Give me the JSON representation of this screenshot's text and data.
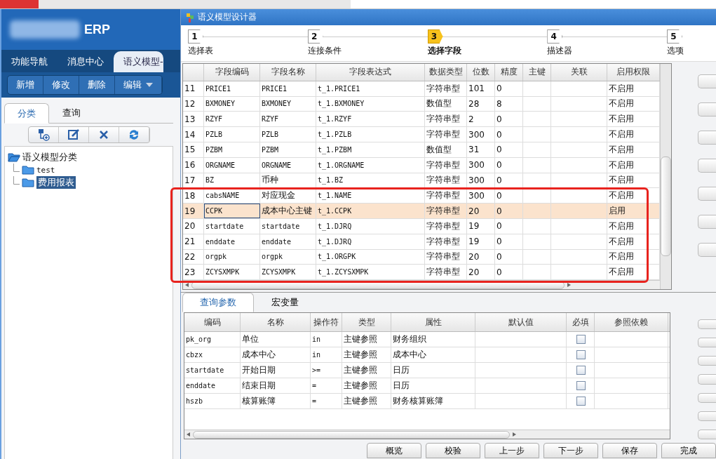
{
  "app": {
    "brand": "ERP"
  },
  "nav_tabs": [
    {
      "label": "功能导航",
      "selected": false
    },
    {
      "label": "消息中心",
      "selected": false
    },
    {
      "label": "语义模型-",
      "selected": true
    }
  ],
  "toolbar": [
    {
      "label": "新增",
      "dropdown": false
    },
    {
      "label": "修改",
      "dropdown": false
    },
    {
      "label": "删除",
      "dropdown": false
    },
    {
      "label": "编辑",
      "dropdown": true
    }
  ],
  "side_tabs": [
    {
      "label": "分类",
      "selected": true
    },
    {
      "label": "查询",
      "selected": false
    }
  ],
  "tree": {
    "label": "语义模型分类",
    "expanded": true,
    "children": [
      {
        "label": "test",
        "selected": false
      },
      {
        "label": "费用报表",
        "selected": true
      }
    ]
  },
  "dialog": {
    "title": "语义模型设计器",
    "steps": [
      {
        "number": "1",
        "label": "选择表",
        "selected": false
      },
      {
        "number": "2",
        "label": "连接条件",
        "selected": false
      },
      {
        "number": "3",
        "label": "选择字段",
        "selected": true
      },
      {
        "number": "4",
        "label": "描述器",
        "selected": false
      },
      {
        "number": "5",
        "label": "选项",
        "selected": false
      }
    ]
  },
  "fields_table": {
    "columns": [
      "",
      "字段编码",
      "字段名称",
      "字段表达式",
      "数据类型",
      "位数",
      "精度",
      "主键",
      "关联",
      "启用权限"
    ],
    "rows": [
      {
        "cells": [
          "11",
          "PRICE1",
          "PRICE1",
          "t_1.PRICE1",
          "字符串型",
          "101",
          "0",
          "",
          "",
          "不启用"
        ],
        "selected": false
      },
      {
        "cells": [
          "12",
          "BXMONEY",
          "BXMONEY",
          "t_1.BXMONEY",
          "数值型",
          "28",
          "8",
          "",
          "",
          "不启用"
        ],
        "selected": false
      },
      {
        "cells": [
          "13",
          "RZYF",
          "RZYF",
          "t_1.RZYF",
          "字符串型",
          "2",
          "0",
          "",
          "",
          "不启用"
        ],
        "selected": false
      },
      {
        "cells": [
          "14",
          "PZLB",
          "PZLB",
          "t_1.PZLB",
          "字符串型",
          "300",
          "0",
          "",
          "",
          "不启用"
        ],
        "selected": false
      },
      {
        "cells": [
          "15",
          "PZBM",
          "PZBM",
          "t_1.PZBM",
          "数值型",
          "31",
          "0",
          "",
          "",
          "不启用"
        ],
        "selected": false
      },
      {
        "cells": [
          "16",
          "ORGNAME",
          "ORGNAME",
          "t_1.ORGNAME",
          "字符串型",
          "300",
          "0",
          "",
          "",
          "不启用"
        ],
        "selected": false
      },
      {
        "cells": [
          "17",
          "BZ",
          "币种",
          "t_1.BZ",
          "字符串型",
          "300",
          "0",
          "",
          "",
          "不启用"
        ],
        "selected": false
      },
      {
        "cells": [
          "18",
          "cabsNAME",
          "对应现金",
          "t_1.NAME",
          "字符串型",
          "300",
          "0",
          "",
          "",
          "不启用"
        ],
        "selected": false
      },
      {
        "cells": [
          "19",
          "CCPK",
          "成本中心主键",
          "t_1.CCPK",
          "字符串型",
          "20",
          "0",
          "",
          "",
          "启用"
        ],
        "selected": true
      },
      {
        "cells": [
          "20",
          "startdate",
          "startdate",
          "t_1.DJRQ",
          "字符串型",
          "19",
          "0",
          "",
          "",
          "不启用"
        ],
        "selected": false
      },
      {
        "cells": [
          "21",
          "enddate",
          "enddate",
          "t_1.DJRQ",
          "字符串型",
          "19",
          "0",
          "",
          "",
          "不启用"
        ],
        "selected": false
      },
      {
        "cells": [
          "22",
          "orgpk",
          "orgpk",
          "t_1.ORGPK",
          "字符串型",
          "20",
          "0",
          "",
          "",
          "不启用"
        ],
        "selected": false
      },
      {
        "cells": [
          "23",
          "ZCYSXMPK",
          "ZCYSXMPK",
          "t_1.ZCYSXMPK",
          "字符串型",
          "20",
          "0",
          "",
          "",
          "不启用"
        ],
        "selected": false
      }
    ]
  },
  "bottom_tabs": [
    {
      "label": "查询参数",
      "selected": true
    },
    {
      "label": "宏变量",
      "selected": false
    }
  ],
  "params_table": {
    "columns": [
      "编码",
      "名称",
      "操作符",
      "类型",
      "属性",
      "默认值",
      "必填",
      "参照依赖"
    ],
    "rows": [
      {
        "cells": [
          "pk_org",
          "单位",
          "in",
          "主键参照",
          "财务组织",
          ""
        ],
        "required": false
      },
      {
        "cells": [
          "cbzx",
          "成本中心",
          "in",
          "主键参照",
          "成本中心",
          ""
        ],
        "required": false
      },
      {
        "cells": [
          "startdate",
          "开始日期",
          ">=",
          "主键参照",
          "日历",
          ""
        ],
        "required": false
      },
      {
        "cells": [
          "enddate",
          "结束日期",
          "=",
          "主键参照",
          "日历",
          ""
        ],
        "required": false
      },
      {
        "cells": [
          "hszb",
          "核算账簿",
          "=",
          "主键参照",
          "财务核算账簿",
          ""
        ],
        "required": false
      }
    ]
  },
  "buttons": [
    "概览",
    "校验",
    "上一步",
    "下一步",
    "保存",
    "完成"
  ]
}
